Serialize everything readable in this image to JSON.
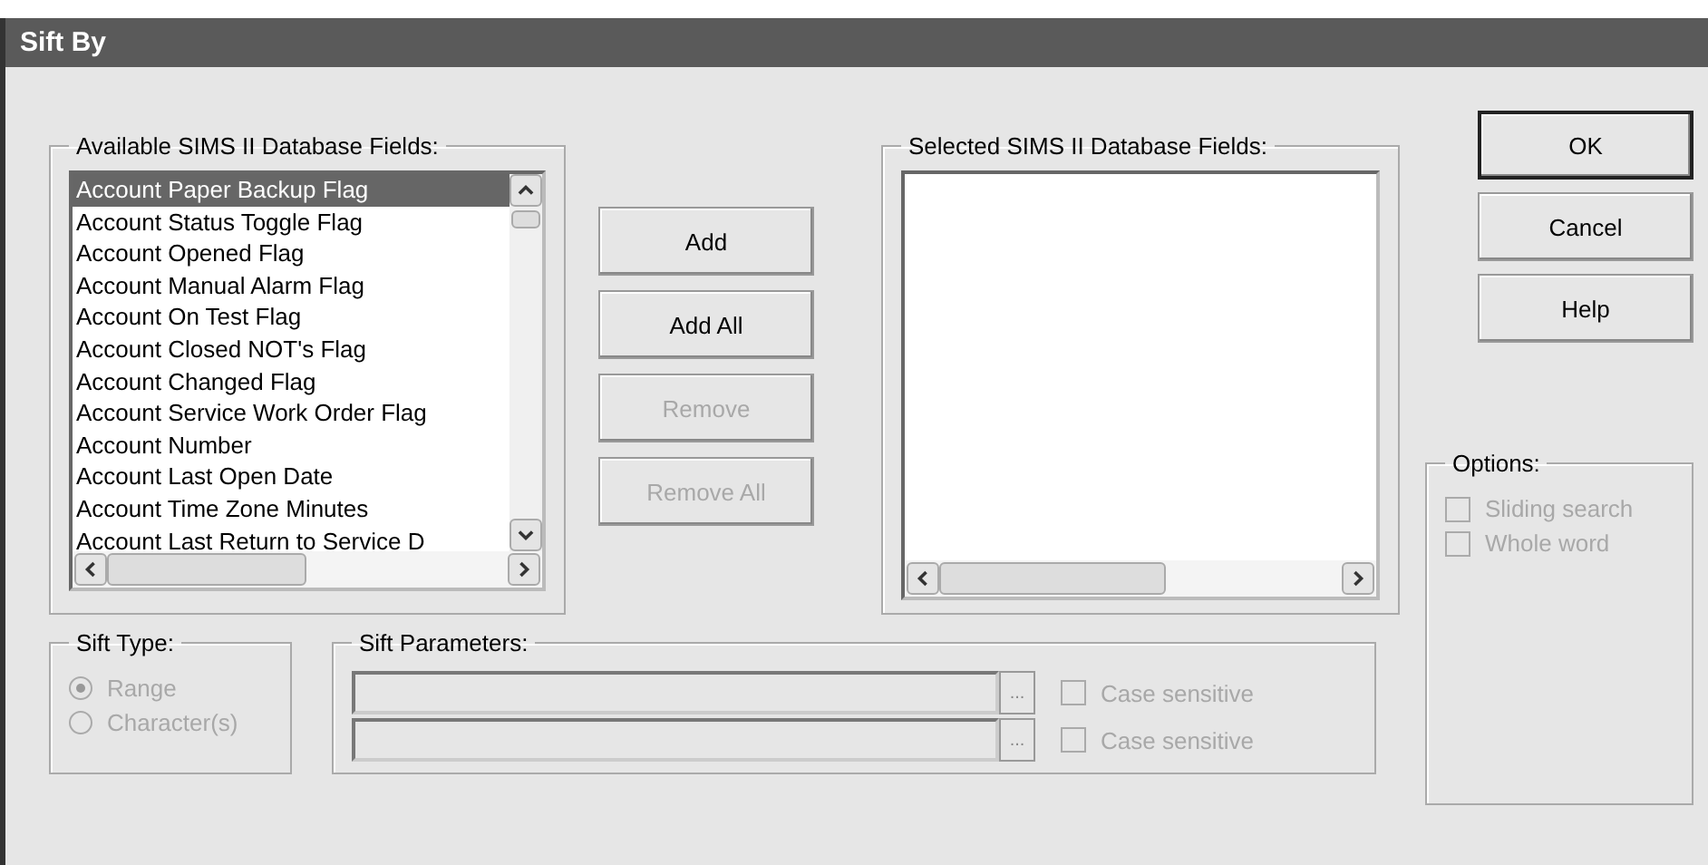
{
  "window": {
    "title": "Sift By"
  },
  "available": {
    "label": "Available SIMS II Database Fields:",
    "items": [
      {
        "text": "Account Paper Backup Flag",
        "selected": true
      },
      {
        "text": "Account Status Toggle Flag",
        "selected": false
      },
      {
        "text": "Account Opened Flag",
        "selected": false
      },
      {
        "text": "Account Manual Alarm Flag",
        "selected": false
      },
      {
        "text": "Account On Test Flag",
        "selected": false
      },
      {
        "text": "Account Closed NOT's Flag",
        "selected": false
      },
      {
        "text": "Account Changed Flag",
        "selected": false
      },
      {
        "text": "Account Service Work Order Flag",
        "selected": false
      },
      {
        "text": "Account Number",
        "selected": false
      },
      {
        "text": "Account Last Open Date",
        "selected": false
      },
      {
        "text": "Account Time Zone Minutes",
        "selected": false
      },
      {
        "text": "Account Last Return to Service D",
        "selected": false
      }
    ]
  },
  "move_buttons": [
    {
      "label": "Add",
      "disabled": false
    },
    {
      "label": "Add All",
      "disabled": false
    },
    {
      "label": "Remove",
      "disabled": true
    },
    {
      "label": "Remove All",
      "disabled": true
    }
  ],
  "selected_fields": {
    "label": "Selected SIMS II Database Fields:"
  },
  "dialog_buttons": [
    {
      "label": "OK",
      "default": true
    },
    {
      "label": "Cancel",
      "default": false
    },
    {
      "label": "Help",
      "default": false
    }
  ],
  "options": {
    "label": "Options:",
    "items": [
      {
        "label": "Sliding search",
        "checked": false,
        "disabled": true
      },
      {
        "label": "Whole word",
        "checked": false,
        "disabled": true
      }
    ]
  },
  "sift_type": {
    "label": "Sift Type:",
    "items": [
      {
        "label": "Range",
        "selected": true,
        "disabled": true
      },
      {
        "label": "Character(s)",
        "selected": false,
        "disabled": true
      }
    ]
  },
  "sift_parameters": {
    "label": "Sift Parameters:",
    "rows": [
      {
        "browse": "...",
        "case_label": "Case sensitive",
        "checked": false,
        "disabled": true
      },
      {
        "browse": "...",
        "case_label": "Case sensitive",
        "checked": false,
        "disabled": true
      }
    ]
  }
}
